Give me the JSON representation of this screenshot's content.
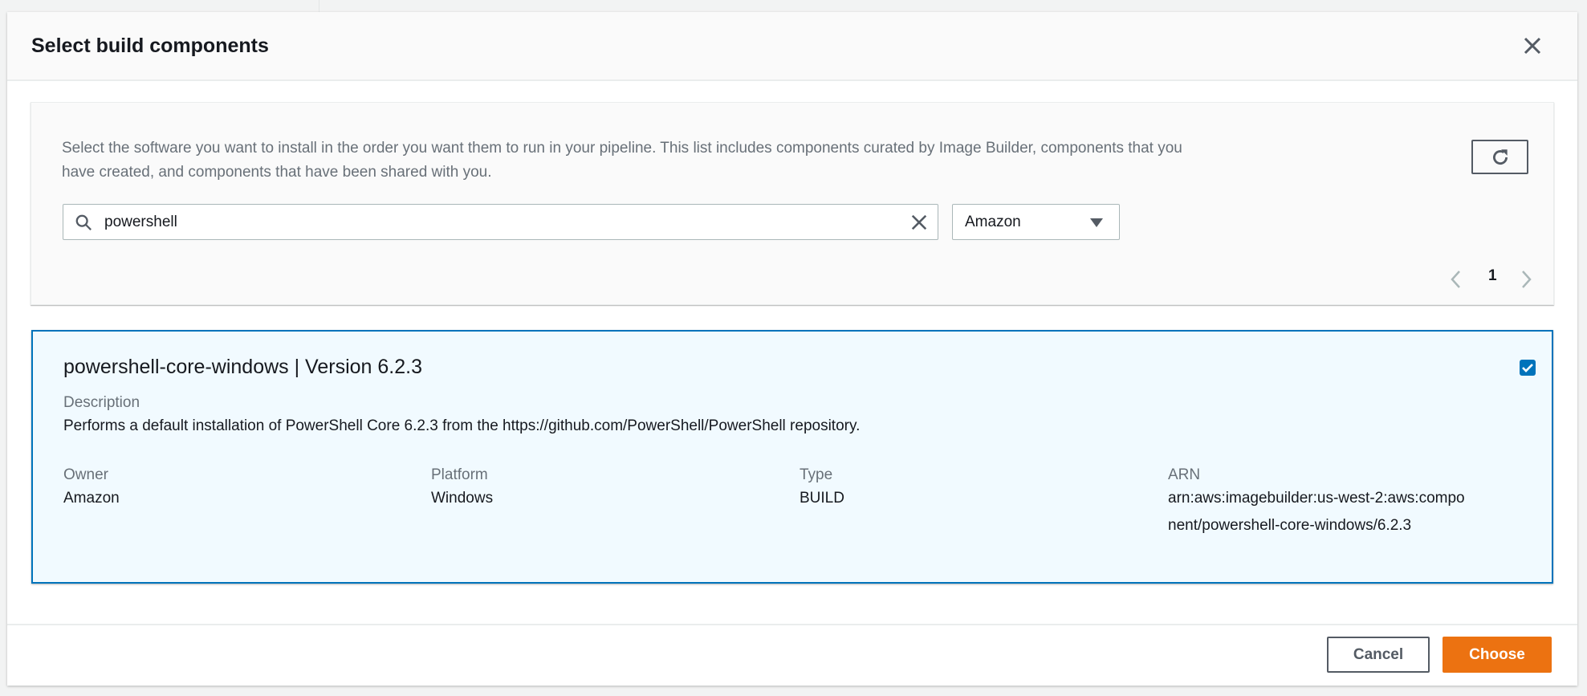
{
  "modal": {
    "title": "Select build components"
  },
  "info": {
    "description": "Select the software you want to install in the order you want them to run in your pipeline. This list includes components curated by Image Builder, components that you have created, and components that have been shared with you.",
    "search_value": "powershell",
    "owner_filter": "Amazon",
    "page": "1"
  },
  "component": {
    "title": "powershell-core-windows | Version 6.2.3",
    "selected": true,
    "description_label": "Description",
    "description": "Performs a default installation of PowerShell Core 6.2.3 from the https://github.com/PowerShell/PowerShell repository.",
    "owner_label": "Owner",
    "owner": "Amazon",
    "platform_label": "Platform",
    "platform": "Windows",
    "type_label": "Type",
    "type": "BUILD",
    "arn_label": "ARN",
    "arn": "arn:aws:imagebuilder:us-west-2:aws:component/powershell-core-windows/6.2.3"
  },
  "footer": {
    "cancel": "Cancel",
    "choose": "Choose"
  },
  "colors": {
    "accent": "#0073bb",
    "primary": "#ec7211"
  }
}
